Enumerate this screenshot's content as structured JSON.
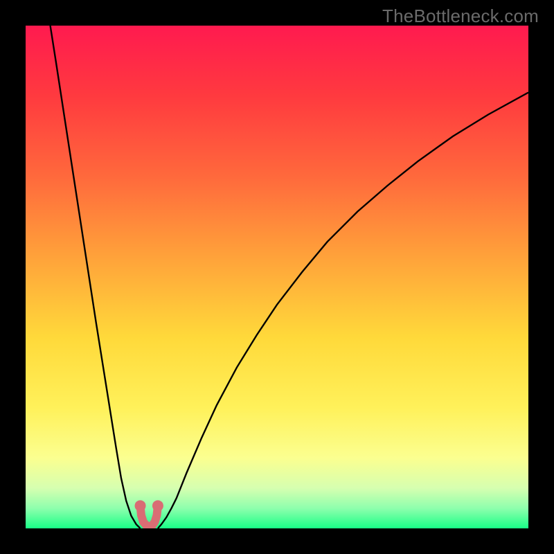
{
  "watermark": "TheBottleneck.com",
  "colors": {
    "frame": "#000000",
    "curve": "#000000",
    "marker_fill": "#d96d74",
    "marker_stroke": "#d96d74",
    "gradient_stops": [
      {
        "offset": 0.0,
        "color": "#ff1a4f"
      },
      {
        "offset": 0.14,
        "color": "#ff3a3f"
      },
      {
        "offset": 0.3,
        "color": "#ff693c"
      },
      {
        "offset": 0.46,
        "color": "#ffa23a"
      },
      {
        "offset": 0.62,
        "color": "#ffd93a"
      },
      {
        "offset": 0.76,
        "color": "#fff15a"
      },
      {
        "offset": 0.86,
        "color": "#fbff90"
      },
      {
        "offset": 0.92,
        "color": "#d6ffb0"
      },
      {
        "offset": 0.96,
        "color": "#8effad"
      },
      {
        "offset": 1.0,
        "color": "#19ff87"
      }
    ]
  },
  "chart_data": {
    "type": "line",
    "title": "",
    "xlabel": "",
    "ylabel": "",
    "xlim": [
      0,
      100
    ],
    "ylim": [
      0,
      100
    ],
    "series": [
      {
        "name": "left-branch",
        "x": [
          4.9,
          6,
          8,
          10,
          12,
          14,
          16,
          18,
          19,
          20,
          21,
          22,
          22.8
        ],
        "y": [
          100,
          93,
          80,
          67,
          54,
          41,
          28.5,
          16,
          10,
          5.5,
          2.5,
          0.8,
          0
        ]
      },
      {
        "name": "right-branch",
        "x": [
          26.3,
          27,
          28,
          29,
          30,
          32,
          35,
          38,
          42,
          46,
          50,
          55,
          60,
          66,
          72,
          78,
          85,
          92,
          100
        ],
        "y": [
          0,
          0.8,
          2.2,
          4,
          6,
          11,
          18,
          24.5,
          32,
          38.5,
          44.5,
          51,
          57,
          63,
          68.2,
          73,
          78,
          82.3,
          86.7
        ]
      }
    ],
    "bottom_segment": {
      "name": "valley-markers",
      "points": [
        {
          "x": 22.8,
          "y": 4.5
        },
        {
          "x": 23.0,
          "y": 2.6
        },
        {
          "x": 23.4,
          "y": 1.3
        },
        {
          "x": 24.0,
          "y": 0.6
        },
        {
          "x": 24.6,
          "y": 0.4
        },
        {
          "x": 25.2,
          "y": 0.6
        },
        {
          "x": 25.7,
          "y": 1.3
        },
        {
          "x": 26.1,
          "y": 2.6
        },
        {
          "x": 26.3,
          "y": 4.5
        }
      ]
    }
  }
}
